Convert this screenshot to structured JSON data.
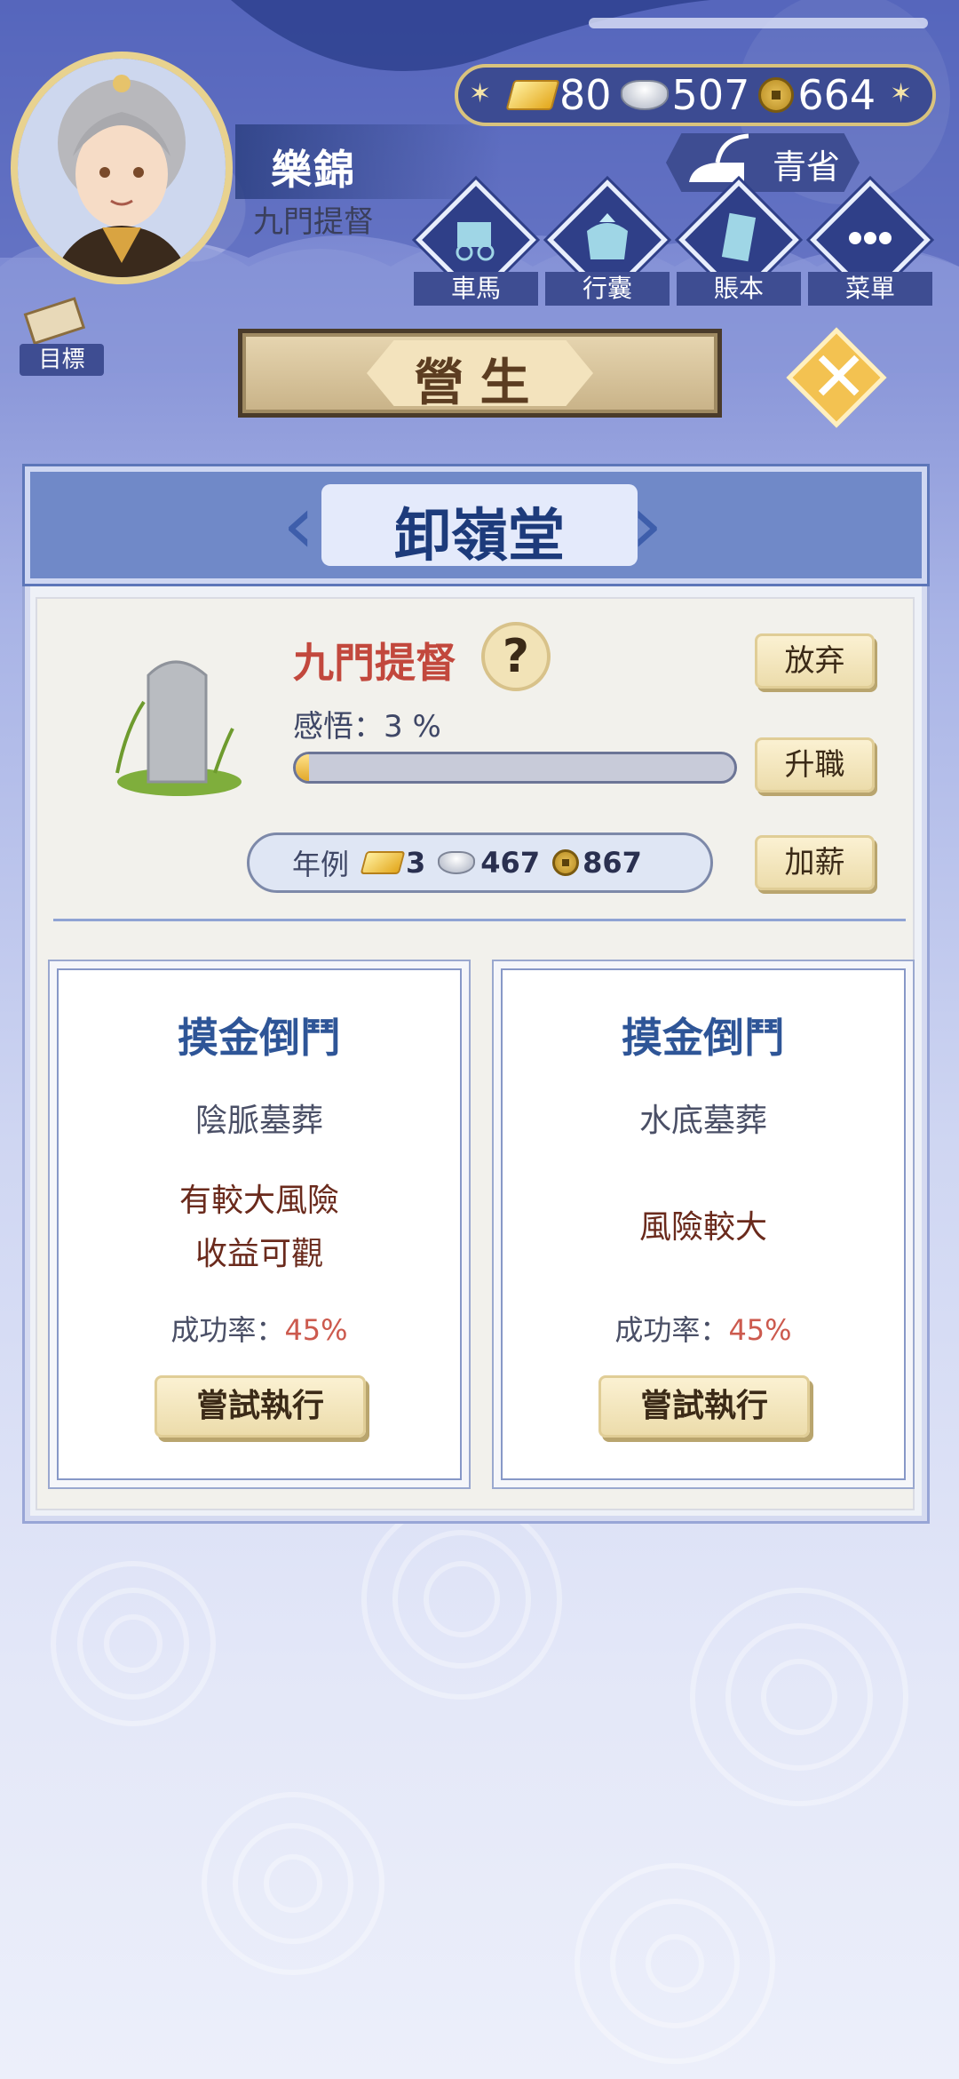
{
  "player": {
    "name": "樂錦",
    "title": "九門提督"
  },
  "currency": {
    "gold": "80",
    "silver": "507",
    "copper": "664"
  },
  "qingsheng": {
    "label": "青省"
  },
  "menu": {
    "items": [
      {
        "label": "車馬",
        "icon": "carriage-icon"
      },
      {
        "label": "行囊",
        "icon": "bundle-icon"
      },
      {
        "label": "賬本",
        "icon": "ledger-icon"
      },
      {
        "label": "菜單",
        "icon": "menu-dots-icon"
      }
    ]
  },
  "goal": {
    "label": "目標"
  },
  "header": {
    "title": "營生"
  },
  "panel": {
    "title": "卸嶺堂"
  },
  "job": {
    "title": "九門提督",
    "insight_label": "感悟：",
    "insight_value": "3 %",
    "progress": 0.03,
    "buttons": {
      "abandon": "放弃",
      "promote": "升職",
      "raise": "加薪"
    },
    "salary": {
      "label": "年例",
      "gold": "3",
      "silver": "467",
      "copper": "867"
    }
  },
  "options": [
    {
      "title": "摸金倒鬥",
      "subtitle": "陰脈墓葬",
      "desc_line1": "有較大風險",
      "desc_line2": "收益可觀",
      "rate_label": "成功率：",
      "rate_value": "45%",
      "button": "嘗試執行"
    },
    {
      "title": "摸金倒鬥",
      "subtitle": "水底墓葬",
      "desc_line1": "風險較大",
      "desc_line2": "",
      "rate_label": "成功率：",
      "rate_value": "45%",
      "button": "嘗試執行"
    }
  ],
  "colors": {
    "accent_blue": "#3e4d92",
    "job_title_red": "#c2483d",
    "option_title_blue": "#2e5597",
    "rate_red": "#cc5a4e"
  }
}
